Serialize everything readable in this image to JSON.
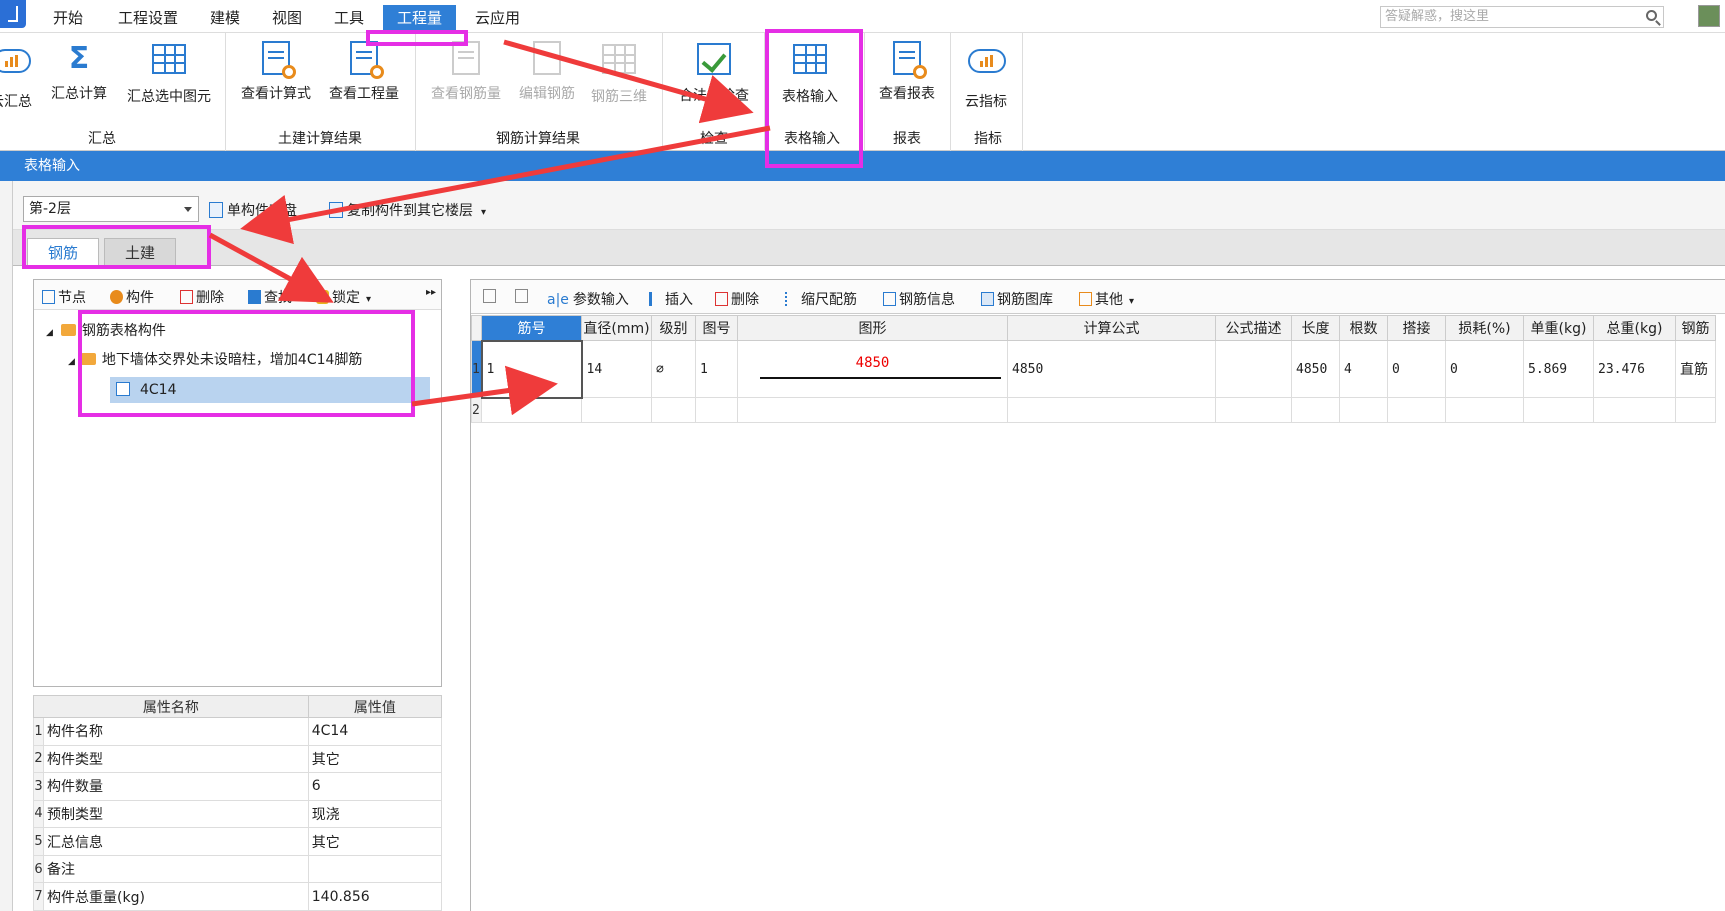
{
  "menu": {
    "items": [
      "开始",
      "工程设置",
      "建模",
      "视图",
      "工具",
      "工程量",
      "云应用"
    ],
    "active_index": 5,
    "search_placeholder": "答疑解惑，搜这里"
  },
  "ribbon": {
    "groups": [
      {
        "label": "汇总",
        "buttons": [
          "云汇总",
          "汇总计算",
          "汇总选中图元"
        ]
      },
      {
        "label": "土建计算结果",
        "buttons": [
          "查看计算式",
          "查看工程量"
        ]
      },
      {
        "label": "钢筋计算结果",
        "buttons": [
          "查看钢筋量",
          "编辑钢筋",
          "钢筋三维"
        ]
      },
      {
        "label": "检查",
        "buttons": [
          "合法性检查"
        ]
      },
      {
        "label": "表格输入",
        "buttons": [
          "表格输入"
        ]
      },
      {
        "label": "报表",
        "buttons": [
          "查看报表"
        ]
      },
      {
        "label": "指标",
        "buttons": [
          "云指标"
        ]
      }
    ],
    "cloud_summary_partial": "云汇总"
  },
  "panel_title": "表格输入",
  "floor_bar": {
    "floor_value": "第-2层",
    "save_single": "单构件存盘",
    "copy_to_floors": "复制构件到其它楼层"
  },
  "tabs": [
    "钢筋",
    "土建"
  ],
  "left_toolbar": [
    "节点",
    "构件",
    "删除",
    "查找",
    "锁定"
  ],
  "tree": {
    "root": "钢筋表格构件",
    "node": "地下墙体交界处未设暗柱，增加4C14脚筋",
    "leaf": "4C14"
  },
  "props": {
    "header_name": "属性名称",
    "header_value": "属性值",
    "rows": [
      {
        "n": "1",
        "name": "构件名称",
        "value": "4C14"
      },
      {
        "n": "2",
        "name": "构件类型",
        "value": "其它"
      },
      {
        "n": "3",
        "name": "构件数量",
        "value": "6"
      },
      {
        "n": "4",
        "name": "预制类型",
        "value": "现浇"
      },
      {
        "n": "5",
        "name": "汇总信息",
        "value": "其它"
      },
      {
        "n": "6",
        "name": "备注",
        "value": ""
      },
      {
        "n": "7",
        "name": "构件总重量(kg)",
        "value": "140.856"
      }
    ]
  },
  "right_toolbar": [
    "参数输入",
    "插入",
    "删除",
    "缩尺配筋",
    "钢筋信息",
    "钢筋图库",
    "其他"
  ],
  "grid": {
    "headers": [
      "筋号",
      "直径(mm)",
      "级别",
      "图号",
      "图形",
      "计算公式",
      "公式描述",
      "长度",
      "根数",
      "搭接",
      "损耗(%)",
      "单重(kg)",
      "总重(kg)",
      "钢筋"
    ],
    "rows": [
      {
        "rn": "1",
        "bar_no": "1",
        "diameter": "14",
        "grade": "⌀",
        "fig": "1",
        "shape": "4850",
        "formula": "4850",
        "desc": "",
        "length": "4850",
        "count": "4",
        "lap": "0",
        "loss": "0",
        "unit_w": "5.869",
        "total_w": "23.476",
        "type": "直筋"
      },
      {
        "rn": "2",
        "bar_no": "",
        "diameter": "",
        "grade": "",
        "fig": "",
        "shape": "",
        "formula": "",
        "desc": "",
        "length": "",
        "count": "",
        "lap": "",
        "loss": "",
        "unit_w": "",
        "total_w": "",
        "type": ""
      }
    ]
  },
  "colors": {
    "accent": "#2f7fd6",
    "highlight_box": "#e52ee5",
    "arrow": "#ef3b3b"
  }
}
